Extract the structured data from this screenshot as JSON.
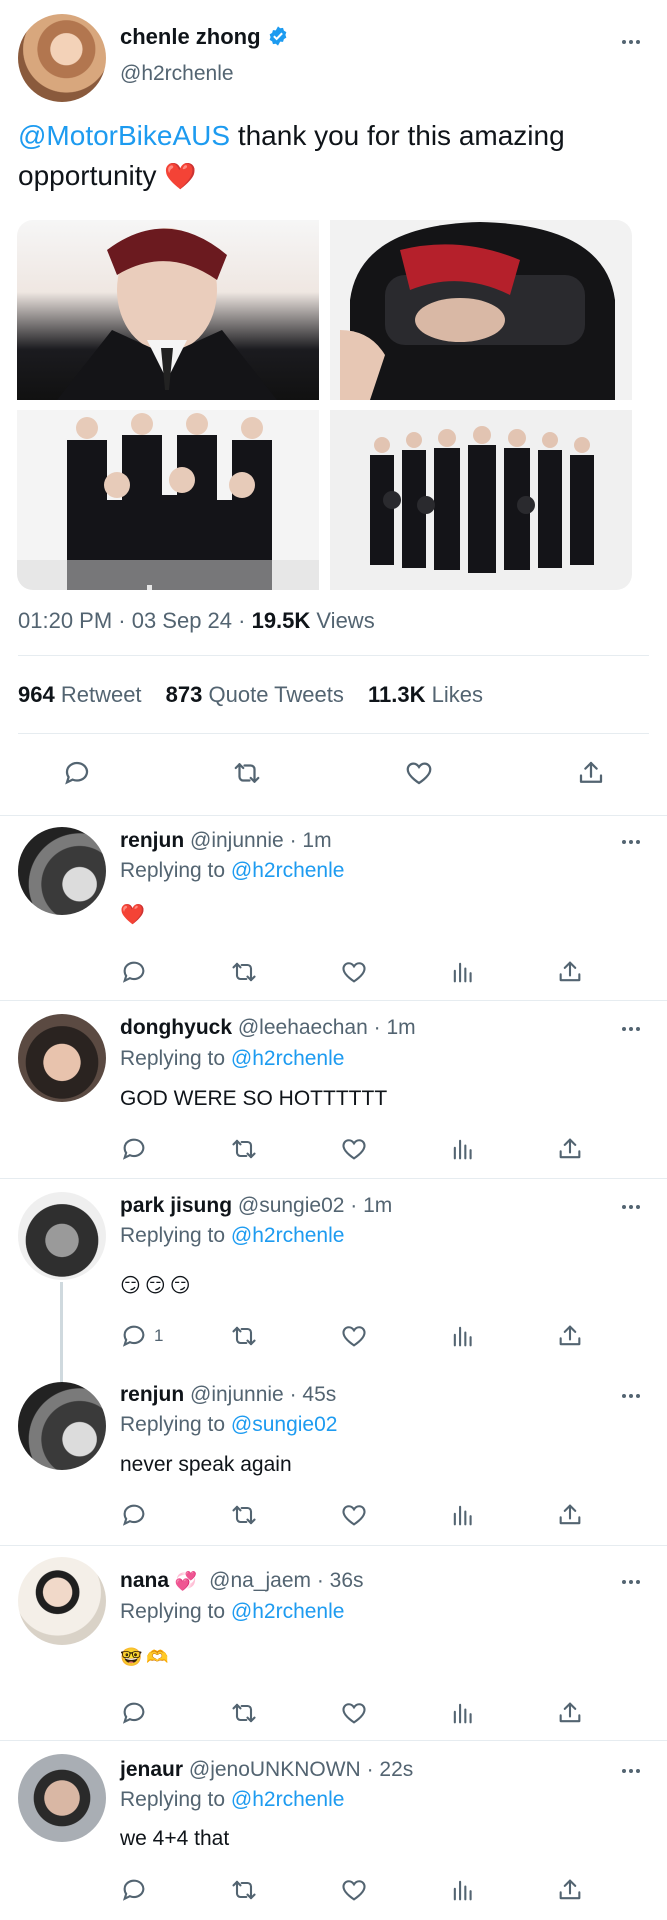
{
  "main_tweet": {
    "display_name": "chenle zhong",
    "handle": "@h2rchenle",
    "mention": "@MotorBikeAUS",
    "text_line1": " thank you for this amazing",
    "text_line2": "opportunity ",
    "heart_emoji": "❤️",
    "time": "01:20 PM · 03 Sep 24 · ",
    "views_count": "19.5K",
    "views_label": " Views",
    "retweets_count": "964",
    "retweets_label": " Retweet",
    "quotes_count": "873",
    "quotes_label": " Quote Tweets",
    "likes_count": "11.3K",
    "likes_label": " Likes"
  },
  "replies": [
    {
      "name": "renjun",
      "handle": "@injunnie",
      "time": " · 1m",
      "replying_label": "Replying to ",
      "replying_to": "@h2rchenle",
      "text": "❤️",
      "reply_count": ""
    },
    {
      "name": "donghyuck",
      "handle": "@leehaechan",
      "time": " · 1m",
      "replying_label": "Replying to ",
      "replying_to": "@h2rchenle",
      "text": "GOD WERE SO HOTTTTTT",
      "reply_count": ""
    },
    {
      "name": "park jisung",
      "handle": "@sungie02",
      "time": " · 1m",
      "replying_label": "Replying to ",
      "replying_to": "@h2rchenle",
      "text": "😏😏😏",
      "reply_count": "1"
    },
    {
      "name": "renjun",
      "handle": "@injunnie",
      "time": " · 45s",
      "replying_label": "Replying to ",
      "replying_to": "@sungie02",
      "text": "never speak again",
      "reply_count": ""
    },
    {
      "name": "nana",
      "name_emoji": "💞",
      "handle": "@na_jaem",
      "time": " · 36s",
      "replying_label": "Replying to ",
      "replying_to": "@h2rchenle",
      "text": "🤓🫶",
      "reply_count": ""
    },
    {
      "name": "jenaur",
      "handle": "@jenoUNKNOWN",
      "time": " · 22s",
      "replying_label": "Replying to ",
      "replying_to": "@h2rchenle",
      "text": "we 4+4 that",
      "reply_count": ""
    }
  ],
  "colors": {
    "accent": "#1d9bf0",
    "text": "#0f1419",
    "secondary": "#536471",
    "like_red": "#e0245e"
  }
}
